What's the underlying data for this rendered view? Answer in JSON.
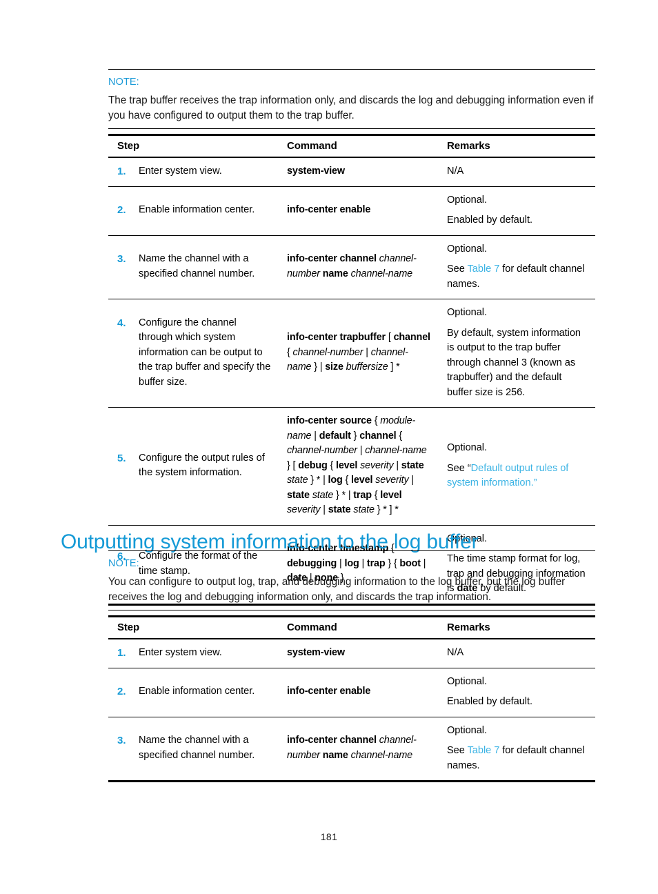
{
  "page": {
    "number": "181"
  },
  "note1": {
    "label": "NOTE:",
    "text": "The trap buffer receives the trap information only, and discards the log and debugging information even if you have configured to output them to the trap buffer."
  },
  "heading": {
    "text": "Outputting system information to the log buffer"
  },
  "note2": {
    "label": "NOTE:",
    "text": "You can configure to output log, trap, and debugging information to the log buffer, but the log buffer receives the log and debugging information only, and discards the trap information."
  },
  "table1": {
    "headers": {
      "step": "Step",
      "command": "Command",
      "remarks": "Remarks"
    },
    "rows": [
      {
        "num": "1.",
        "step": "Enter system view.",
        "command_parts": [
          {
            "text": "system-view",
            "style": "bold"
          }
        ],
        "remarks_lines": [
          [
            {
              "text": "N/A",
              "style": "plain"
            }
          ]
        ]
      },
      {
        "num": "2.",
        "step": "Enable information center.",
        "command_parts": [
          {
            "text": "info-center enable",
            "style": "bold"
          }
        ],
        "remarks_lines": [
          [
            {
              "text": "Optional.",
              "style": "plain"
            }
          ],
          [
            {
              "text": "Enabled by default.",
              "style": "plain"
            }
          ]
        ]
      },
      {
        "num": "3.",
        "step": "Name the channel with a specified channel number.",
        "command_parts": [
          {
            "text": "info-center channel",
            "style": "bold"
          },
          {
            "text": " ",
            "style": "plain"
          },
          {
            "text": "channel-number",
            "style": "italic"
          },
          {
            "text": " ",
            "style": "plain"
          },
          {
            "text": "name",
            "style": "bold"
          },
          {
            "text": " ",
            "style": "plain"
          },
          {
            "text": "channel-name",
            "style": "italic"
          }
        ],
        "remarks_lines": [
          [
            {
              "text": "Optional.",
              "style": "plain"
            }
          ],
          [
            {
              "text": "See ",
              "style": "plain"
            },
            {
              "text": "Table 7",
              "style": "link"
            },
            {
              "text": " for default channel names.",
              "style": "plain"
            }
          ]
        ]
      },
      {
        "num": "4.",
        "step": "Configure the channel through which system information can be output to the trap buffer and specify the buffer size.",
        "command_parts": [
          {
            "text": "info-center trapbuffer",
            "style": "bold"
          },
          {
            "text": " [ ",
            "style": "plain"
          },
          {
            "text": "channel",
            "style": "bold"
          },
          {
            "text": " { ",
            "style": "plain"
          },
          {
            "text": "channel-number",
            "style": "italic"
          },
          {
            "text": " | ",
            "style": "plain"
          },
          {
            "text": "channel-name",
            "style": "italic"
          },
          {
            "text": " } | ",
            "style": "plain"
          },
          {
            "text": "size",
            "style": "bold"
          },
          {
            "text": " ",
            "style": "plain"
          },
          {
            "text": "buffersize",
            "style": "italic"
          },
          {
            "text": " ] *",
            "style": "plain"
          }
        ],
        "remarks_lines": [
          [
            {
              "text": "Optional.",
              "style": "plain"
            }
          ],
          [
            {
              "text": "By default, system information is output to the trap buffer through channel 3 (known as trapbuffer) and the default buffer size is 256.",
              "style": "plain"
            }
          ]
        ]
      },
      {
        "num": "5.",
        "step": "Configure the output rules of the system information.",
        "command_parts": [
          {
            "text": "info-center source",
            "style": "bold"
          },
          {
            "text": " { ",
            "style": "plain"
          },
          {
            "text": "module-name",
            "style": "italic"
          },
          {
            "text": " | ",
            "style": "plain"
          },
          {
            "text": "default",
            "style": "bold"
          },
          {
            "text": " } ",
            "style": "plain"
          },
          {
            "text": "channel",
            "style": "bold"
          },
          {
            "text": " { ",
            "style": "plain"
          },
          {
            "text": "channel-number",
            "style": "italic"
          },
          {
            "text": " | ",
            "style": "plain"
          },
          {
            "text": "channel-name",
            "style": "italic"
          },
          {
            "text": " } [ ",
            "style": "plain"
          },
          {
            "text": "debug",
            "style": "bold"
          },
          {
            "text": " { ",
            "style": "plain"
          },
          {
            "text": "level",
            "style": "bold"
          },
          {
            "text": " ",
            "style": "plain"
          },
          {
            "text": "severity",
            "style": "italic"
          },
          {
            "text": " | ",
            "style": "plain"
          },
          {
            "text": "state",
            "style": "bold"
          },
          {
            "text": " ",
            "style": "plain"
          },
          {
            "text": "state",
            "style": "italic"
          },
          {
            "text": " } * | ",
            "style": "plain"
          },
          {
            "text": "log",
            "style": "bold"
          },
          {
            "text": " { ",
            "style": "plain"
          },
          {
            "text": "level",
            "style": "bold"
          },
          {
            "text": " ",
            "style": "plain"
          },
          {
            "text": "severity",
            "style": "italic"
          },
          {
            "text": " | ",
            "style": "plain"
          },
          {
            "text": "state",
            "style": "bold"
          },
          {
            "text": " ",
            "style": "plain"
          },
          {
            "text": "state",
            "style": "italic"
          },
          {
            "text": " } * | ",
            "style": "plain"
          },
          {
            "text": "trap",
            "style": "bold"
          },
          {
            "text": " { ",
            "style": "plain"
          },
          {
            "text": "level",
            "style": "bold"
          },
          {
            "text": " ",
            "style": "plain"
          },
          {
            "text": "severity",
            "style": "italic"
          },
          {
            "text": " | ",
            "style": "plain"
          },
          {
            "text": "state",
            "style": "bold"
          },
          {
            "text": " ",
            "style": "plain"
          },
          {
            "text": "state",
            "style": "italic"
          },
          {
            "text": " } * ] *",
            "style": "plain"
          }
        ],
        "remarks_lines": [
          [
            {
              "text": "Optional.",
              "style": "plain"
            }
          ],
          [
            {
              "text": "See “",
              "style": "plain"
            },
            {
              "text": "Default output rules of system information.”",
              "style": "link"
            }
          ]
        ]
      },
      {
        "num": "6.",
        "step": "Configure the format of the time stamp.",
        "command_parts": [
          {
            "text": "info-center timestamp",
            "style": "bold"
          },
          {
            "text": " { ",
            "style": "plain"
          },
          {
            "text": "debugging",
            "style": "bold"
          },
          {
            "text": " | ",
            "style": "plain"
          },
          {
            "text": "log",
            "style": "bold"
          },
          {
            "text": " | ",
            "style": "plain"
          },
          {
            "text": "trap",
            "style": "bold"
          },
          {
            "text": " } { ",
            "style": "plain"
          },
          {
            "text": "boot",
            "style": "bold"
          },
          {
            "text": " | ",
            "style": "plain"
          },
          {
            "text": "date",
            "style": "bold"
          },
          {
            "text": " | ",
            "style": "plain"
          },
          {
            "text": "none",
            "style": "bold"
          },
          {
            "text": " }",
            "style": "plain"
          }
        ],
        "remarks_lines": [
          [
            {
              "text": "Optional.",
              "style": "plain"
            }
          ],
          [
            {
              "text": "The time stamp format for log, trap and debugging information is ",
              "style": "plain"
            },
            {
              "text": "date",
              "style": "bold"
            },
            {
              "text": " by default.",
              "style": "plain"
            }
          ]
        ]
      }
    ]
  },
  "table2": {
    "headers": {
      "step": "Step",
      "command": "Command",
      "remarks": "Remarks"
    },
    "rows": [
      {
        "num": "1.",
        "step": "Enter system view.",
        "command_parts": [
          {
            "text": "system-view",
            "style": "bold"
          }
        ],
        "remarks_lines": [
          [
            {
              "text": "N/A",
              "style": "plain"
            }
          ]
        ]
      },
      {
        "num": "2.",
        "step": "Enable information center.",
        "command_parts": [
          {
            "text": "info-center enable",
            "style": "bold"
          }
        ],
        "remarks_lines": [
          [
            {
              "text": "Optional.",
              "style": "plain"
            }
          ],
          [
            {
              "text": "Enabled by default.",
              "style": "plain"
            }
          ]
        ]
      },
      {
        "num": "3.",
        "step": "Name the channel with a specified channel number.",
        "command_parts": [
          {
            "text": "info-center channel",
            "style": "bold"
          },
          {
            "text": " ",
            "style": "plain"
          },
          {
            "text": "channel-number",
            "style": "italic"
          },
          {
            "text": " ",
            "style": "plain"
          },
          {
            "text": "name",
            "style": "bold"
          },
          {
            "text": " ",
            "style": "plain"
          },
          {
            "text": "channel-name",
            "style": "italic"
          }
        ],
        "remarks_lines": [
          [
            {
              "text": "Optional.",
              "style": "plain"
            }
          ],
          [
            {
              "text": "See ",
              "style": "plain"
            },
            {
              "text": "Table 7",
              "style": "link"
            },
            {
              "text": " for default channel names.",
              "style": "plain"
            }
          ]
        ]
      }
    ]
  },
  "colors": {
    "heading_blue": "#159ad6",
    "link_blue": "#3bb3e4",
    "note_blue": "#1a9ad7",
    "rule_black": "#000000"
  }
}
